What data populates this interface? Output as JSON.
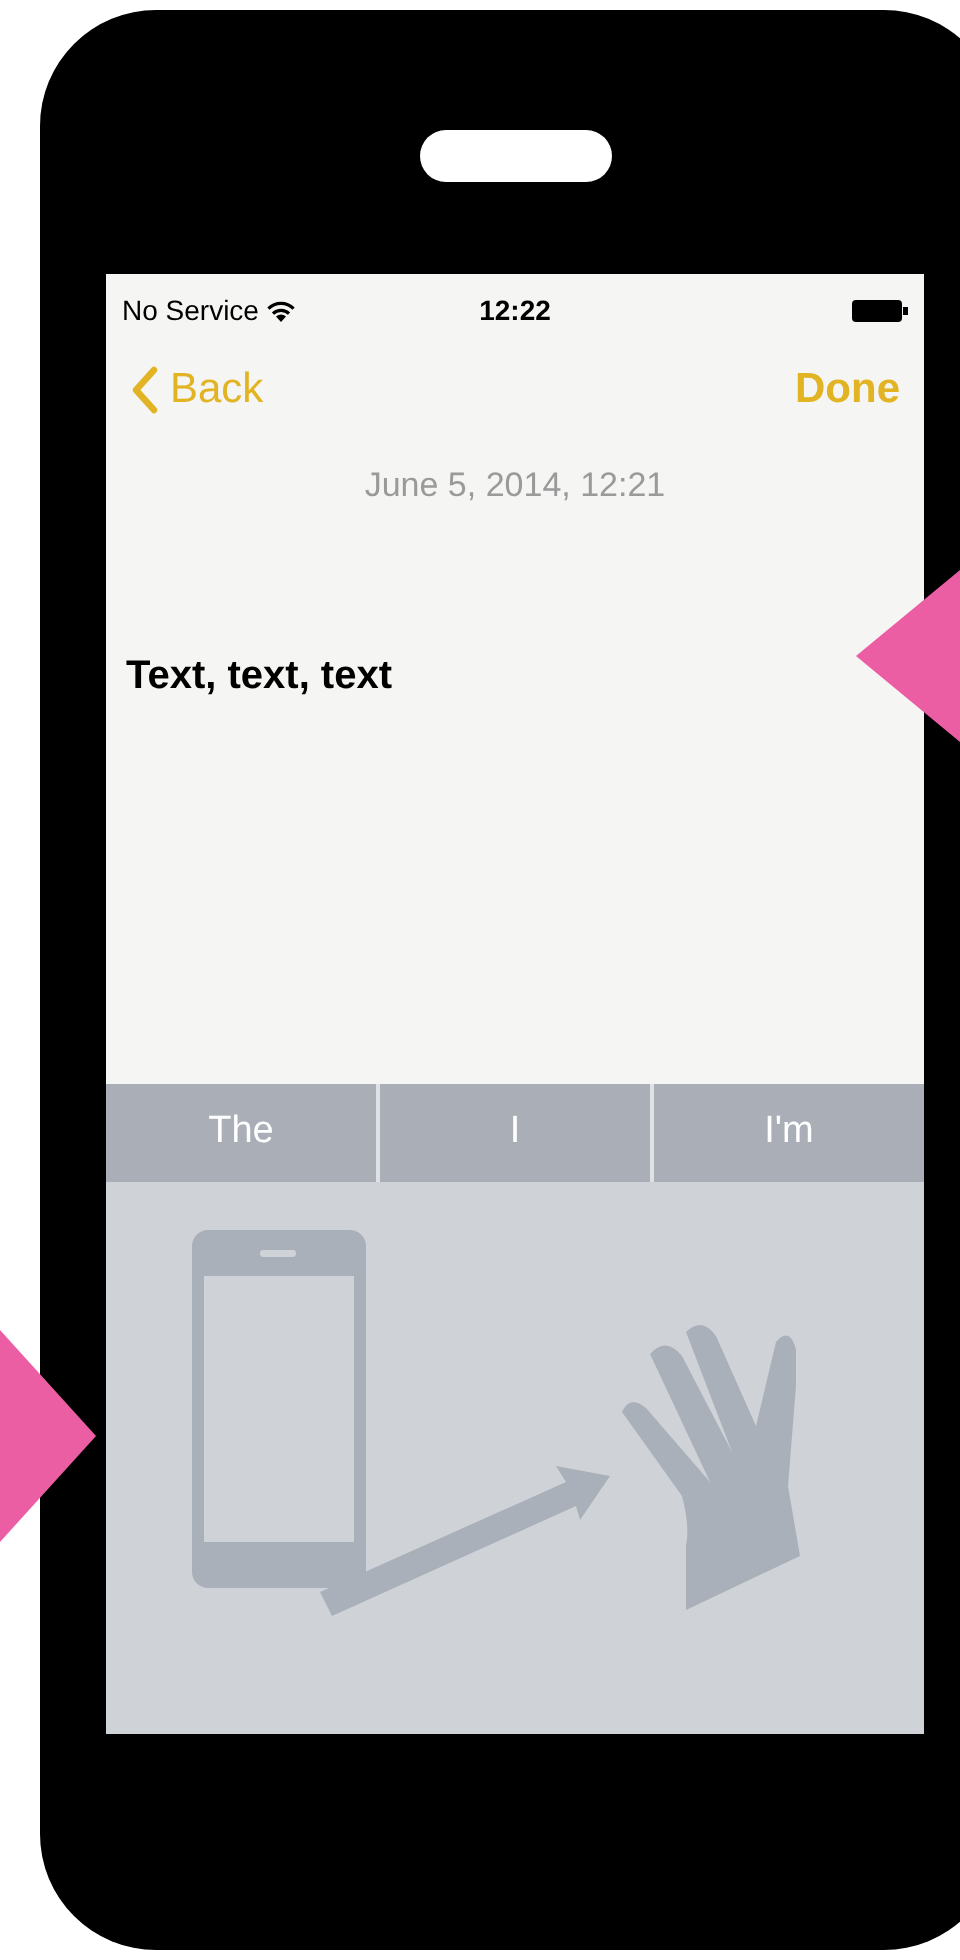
{
  "status_bar": {
    "carrier": "No Service",
    "time": "12:22"
  },
  "nav": {
    "back": "Back",
    "done": "Done"
  },
  "note": {
    "date": "June 5, 2014, 12:21",
    "body": "Text, text, text"
  },
  "suggestions": [
    {
      "label": "The"
    },
    {
      "label": "I"
    },
    {
      "label": "I'm"
    }
  ]
}
